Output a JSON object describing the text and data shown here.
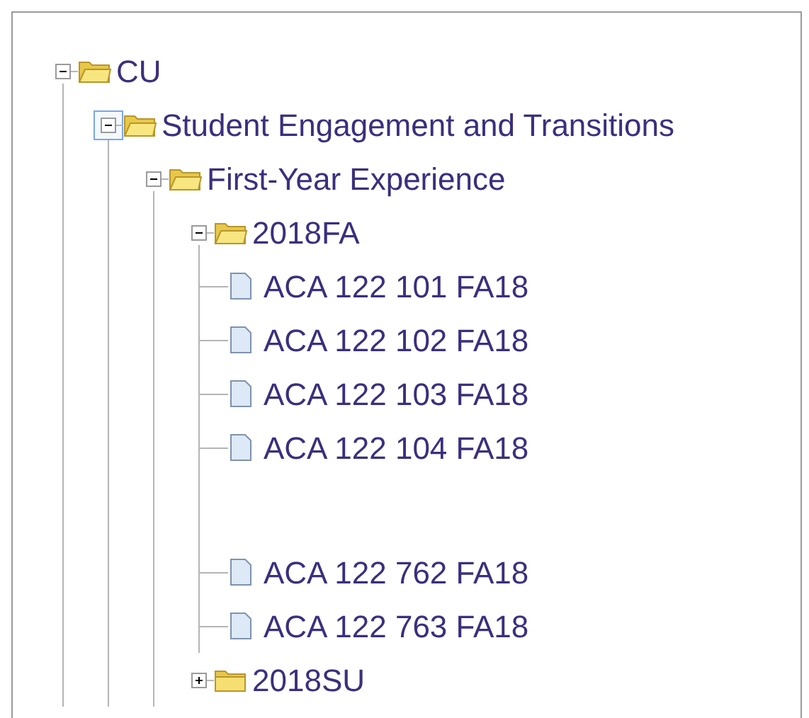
{
  "tree": [
    {
      "kind": "folder",
      "label": "CU",
      "expanded": true,
      "focused": false,
      "children": [
        {
          "kind": "folder",
          "label": "Student Engagement and Transitions",
          "expanded": true,
          "focused": true,
          "children": [
            {
              "kind": "folder",
              "label": "First-Year Experience",
              "expanded": true,
              "focused": false,
              "children": [
                {
                  "kind": "folder",
                  "label": "2018FA",
                  "expanded": true,
                  "focused": false,
                  "children": [
                    {
                      "kind": "doc",
                      "label": "ACA 122 101 FA18"
                    },
                    {
                      "kind": "doc",
                      "label": "ACA 122 102 FA18"
                    },
                    {
                      "kind": "doc",
                      "label": "ACA 122 103 FA18"
                    },
                    {
                      "kind": "doc",
                      "label": "ACA 122 104 FA18"
                    },
                    {
                      "kind": "gap"
                    },
                    {
                      "kind": "doc",
                      "label": "ACA 122 762 FA18"
                    },
                    {
                      "kind": "doc",
                      "label": "ACA 122 763 FA18"
                    }
                  ]
                },
                {
                  "kind": "folder",
                  "label": "2018SU",
                  "expanded": false,
                  "focused": false
                }
              ]
            }
          ]
        }
      ]
    }
  ]
}
